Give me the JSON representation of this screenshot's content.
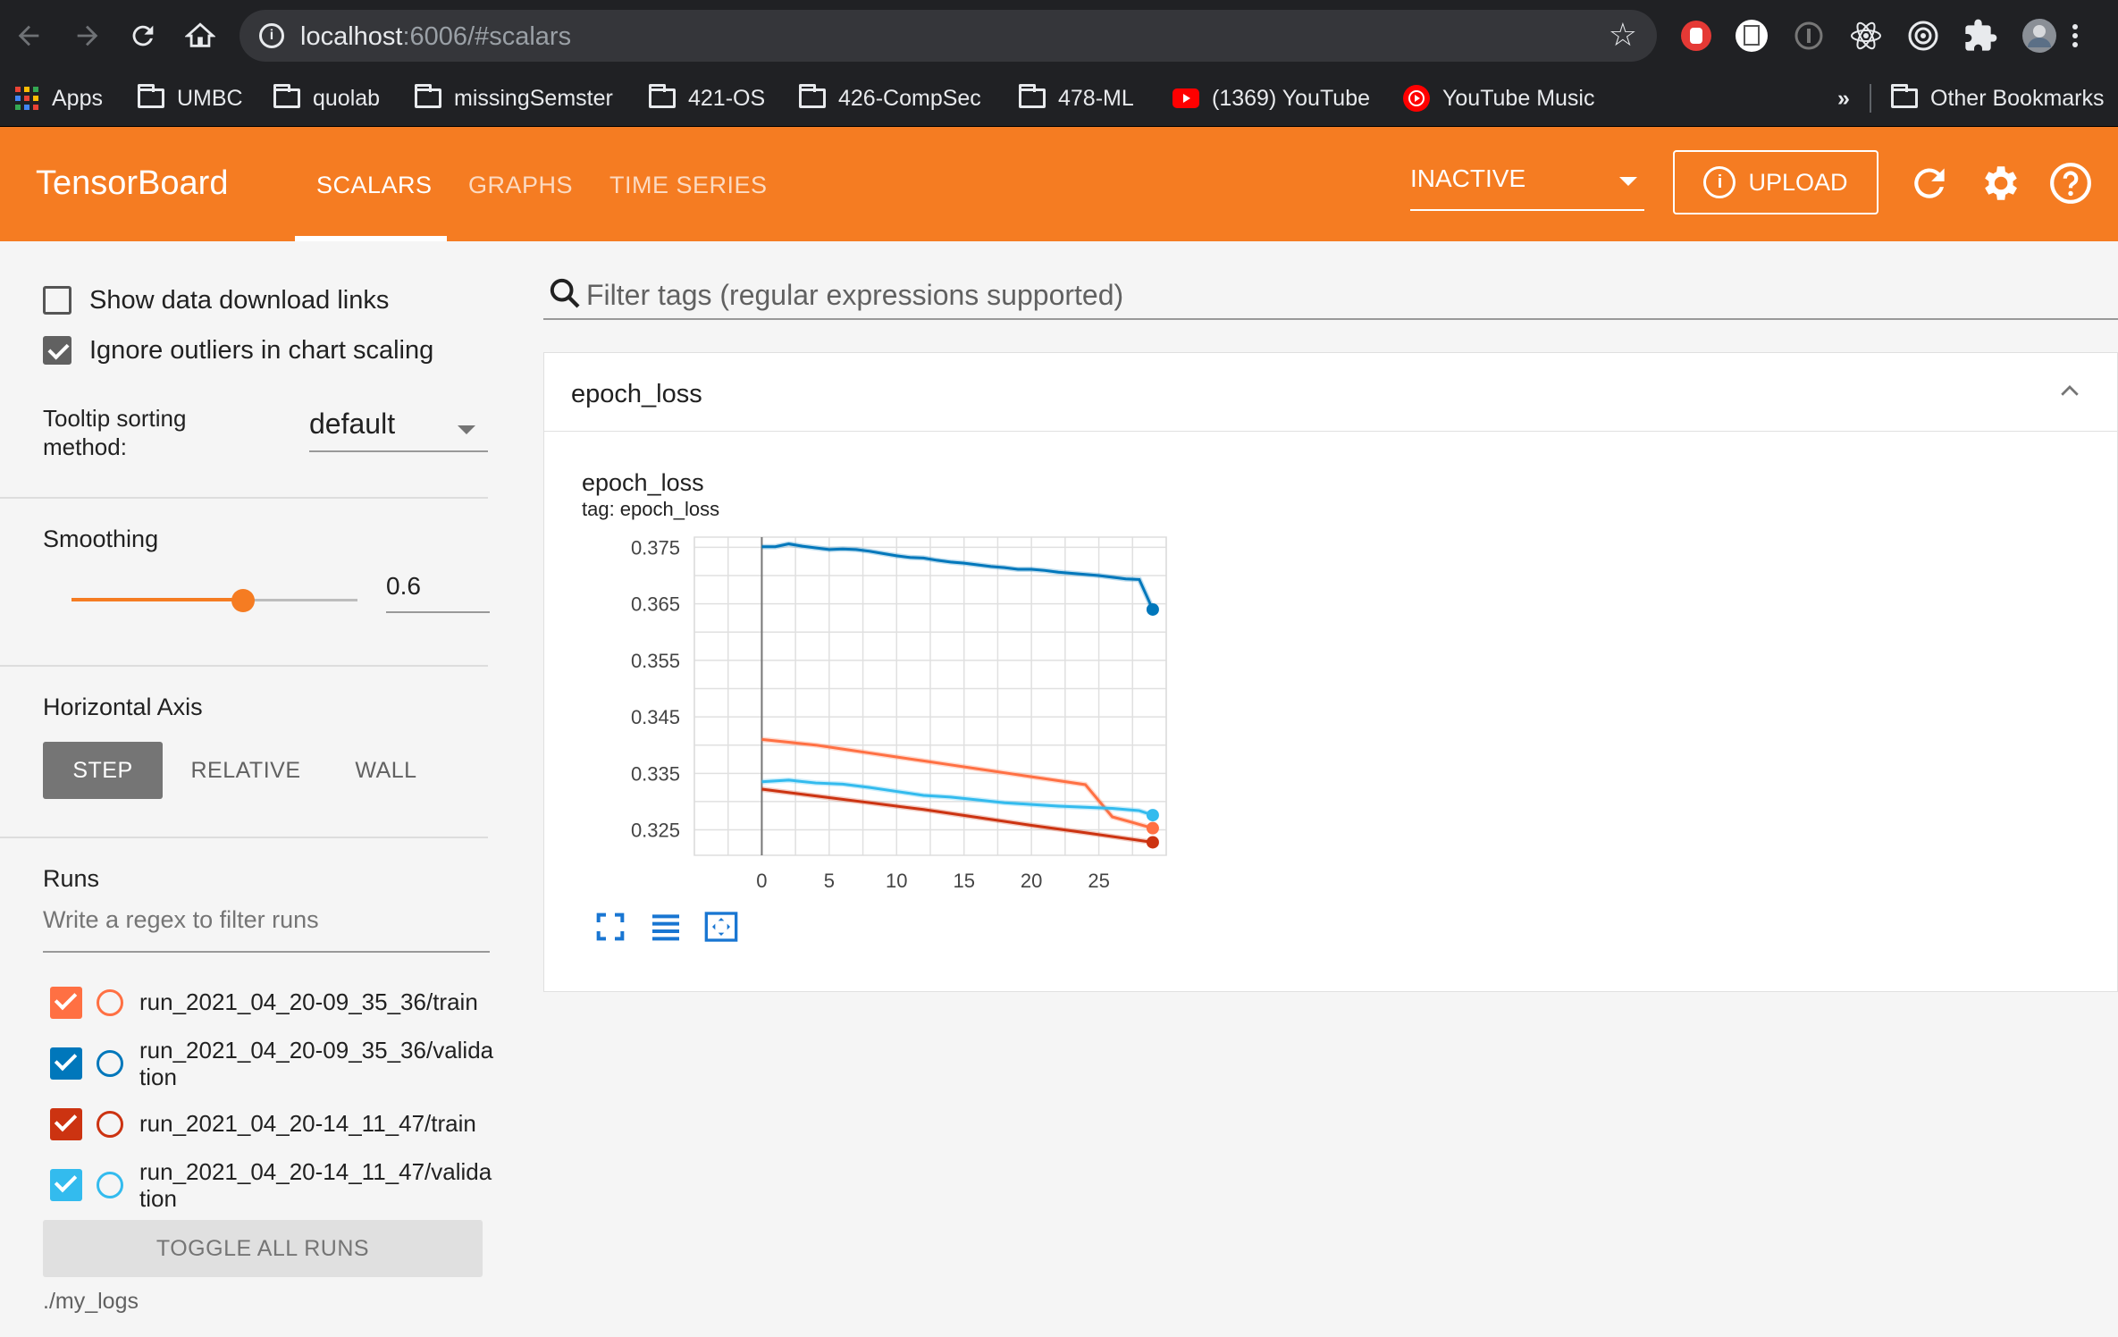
{
  "browser": {
    "url_host": "localhost",
    "url_rest": ":6006/#scalars",
    "bookmarks": [
      {
        "label": "Apps",
        "type": "apps"
      },
      {
        "label": "UMBC",
        "type": "folder"
      },
      {
        "label": "quolab",
        "type": "folder"
      },
      {
        "label": "missingSemster",
        "type": "folder"
      },
      {
        "label": "421-OS",
        "type": "folder"
      },
      {
        "label": "426-CompSec",
        "type": "folder"
      },
      {
        "label": "478-ML",
        "type": "folder"
      },
      {
        "label": "(1369) YouTube",
        "type": "youtube"
      },
      {
        "label": "YouTube Music",
        "type": "ytmusic"
      }
    ],
    "more_bookmarks": "»",
    "other_bookmarks": "Other Bookmarks"
  },
  "app": {
    "brand": "TensorBoard",
    "tabs": [
      "SCALARS",
      "GRAPHS",
      "TIME SERIES"
    ],
    "active_tab": "SCALARS",
    "status_select": "INACTIVE",
    "upload_label": "UPLOAD",
    "accent": "#f57c22"
  },
  "sidebar": {
    "show_download_links": "Show data download links",
    "ignore_outliers": "Ignore outliers in chart scaling",
    "tooltip_sorting_label": "Tooltip sorting method:",
    "tooltip_sorting_value": "default",
    "smoothing_label": "Smoothing",
    "smoothing_value": "0.6",
    "smoothing_level": 0.6,
    "horizontal_axis_label": "Horizontal Axis",
    "axis_options": [
      "STEP",
      "RELATIVE",
      "WALL"
    ],
    "axis_selected": "STEP",
    "runs_label": "Runs",
    "runs_filter_placeholder": "Write a regex to filter runs",
    "runs": [
      {
        "name": "run_2021_04_20-09_35_36/train",
        "color": "#ff7043"
      },
      {
        "name": "run_2021_04_20-09_35_36/validation",
        "color": "#0077bb"
      },
      {
        "name": "run_2021_04_20-14_11_47/train",
        "color": "#cc3311"
      },
      {
        "name": "run_2021_04_20-14_11_47/validation",
        "color": "#33bbee"
      }
    ],
    "toggle_all": "TOGGLE ALL RUNS",
    "logdir": "./my_logs"
  },
  "main": {
    "filter_placeholder": "Filter tags (regular expressions supported)",
    "card_title": "epoch_loss"
  },
  "chart_data": {
    "type": "line",
    "title": "epoch_loss",
    "subtitle": "tag: epoch_loss",
    "xlim": [
      -5,
      30
    ],
    "ylim": [
      0.3205,
      0.3768
    ],
    "xticks": [
      0,
      5,
      10,
      15,
      20,
      25
    ],
    "yticks": [
      0.325,
      0.335,
      0.345,
      0.355,
      0.365,
      0.375
    ],
    "ytick_labels": [
      "0.325",
      "0.335",
      "0.345",
      "0.355",
      "0.365",
      "0.375"
    ],
    "grid": true,
    "series": [
      {
        "color": "#0077bb",
        "x": [
          0,
          1,
          2,
          3,
          4,
          5,
          6,
          7,
          8,
          9,
          10,
          11,
          12,
          13,
          14,
          15,
          16,
          17,
          18,
          19,
          20,
          21,
          22,
          23,
          24,
          25,
          26,
          27,
          28,
          29
        ],
        "y": [
          0.3751,
          0.3751,
          0.3756,
          0.3752,
          0.3749,
          0.3746,
          0.3747,
          0.3746,
          0.3743,
          0.3739,
          0.3735,
          0.3732,
          0.3731,
          0.3727,
          0.3724,
          0.3722,
          0.3719,
          0.3716,
          0.3714,
          0.3711,
          0.3711,
          0.3709,
          0.3706,
          0.3704,
          0.3702,
          0.37,
          0.3697,
          0.3694,
          0.3693,
          0.364
        ]
      },
      {
        "color": "#ff7043",
        "x": [
          0,
          2,
          4,
          6,
          8,
          10,
          12,
          14,
          16,
          18,
          20,
          22,
          24,
          26,
          29
        ],
        "y": [
          0.341,
          0.3405,
          0.34,
          0.3393,
          0.3386,
          0.3379,
          0.3372,
          0.3365,
          0.3358,
          0.3351,
          0.3344,
          0.3337,
          0.333,
          0.3273,
          0.3253
        ]
      },
      {
        "color": "#33bbee",
        "x": [
          0,
          2,
          4,
          6,
          8,
          10,
          12,
          14,
          16,
          18,
          20,
          22,
          24,
          26,
          28,
          29
        ],
        "y": [
          0.3335,
          0.3338,
          0.3333,
          0.3331,
          0.3325,
          0.3318,
          0.3311,
          0.3308,
          0.3303,
          0.3298,
          0.3295,
          0.3292,
          0.329,
          0.3288,
          0.3284,
          0.3276
        ]
      },
      {
        "color": "#cc3311",
        "x": [
          0,
          4,
          8,
          12,
          16,
          20,
          24,
          29
        ],
        "y": [
          0.3322,
          0.331,
          0.3298,
          0.3286,
          0.3272,
          0.3258,
          0.3245,
          0.3228
        ]
      }
    ]
  }
}
